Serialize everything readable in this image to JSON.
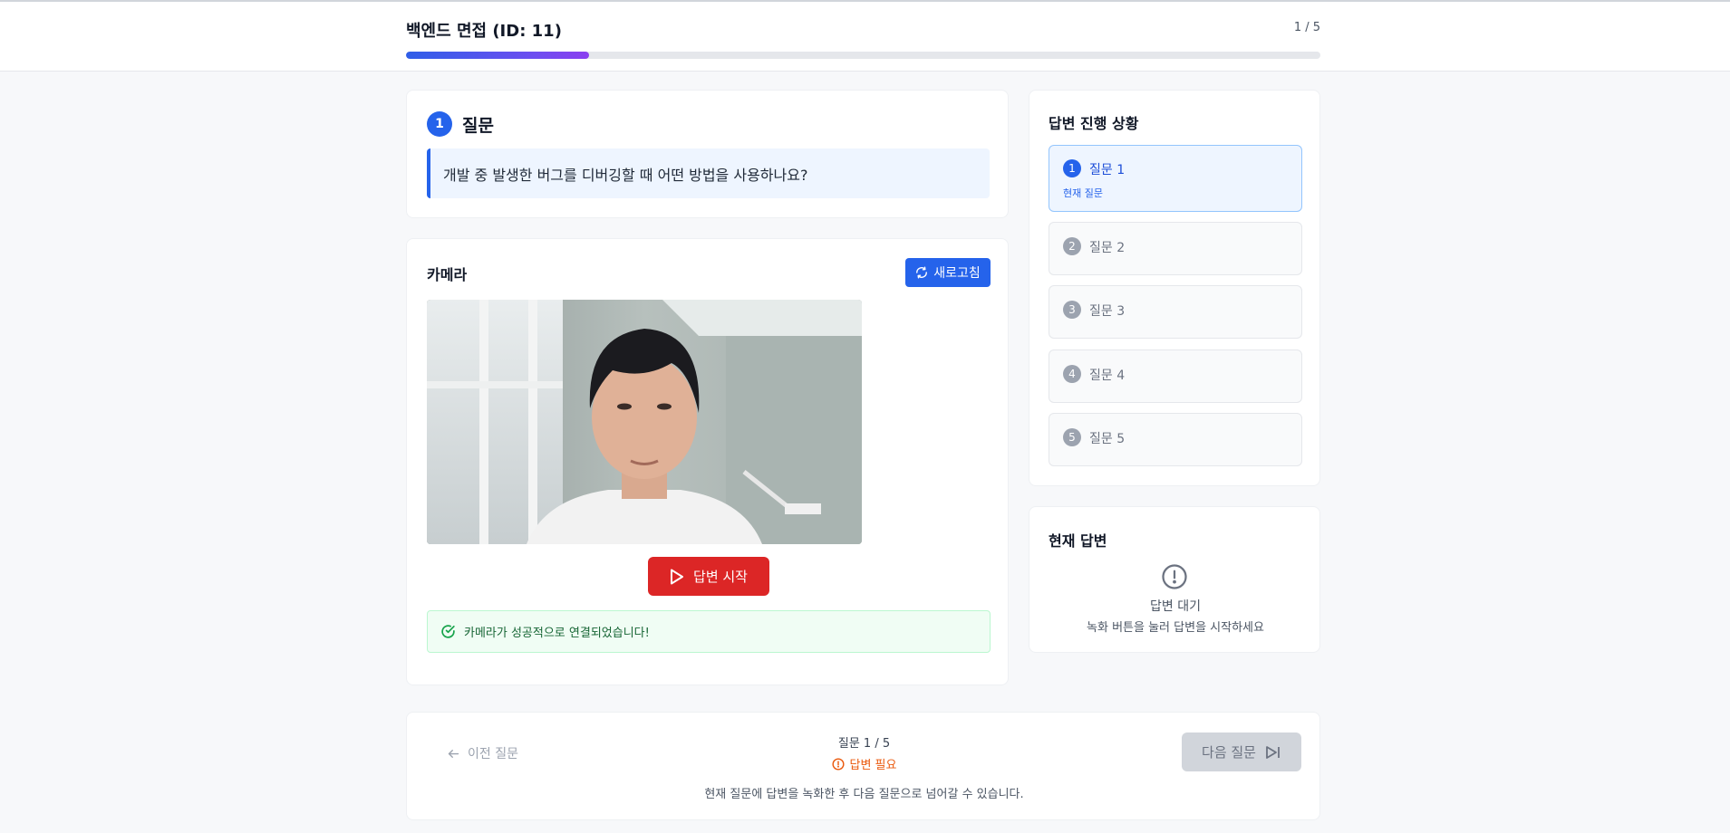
{
  "header": {
    "title": "백엔드 면접 (ID: 11)",
    "counter": "1 / 5",
    "progress": 0.2
  },
  "question": {
    "number": "1",
    "heading": "질문",
    "text": "개발 중 발생한 버그를 디버깅할 때 어떤 방법을 사용하나요?"
  },
  "camera": {
    "title": "카메라",
    "refresh_label": "새로고침",
    "start_label": "답변 시작",
    "success_message": "카메라가 성공적으로 연결되었습니다!"
  },
  "status": {
    "title": "답변 진행 상황",
    "steps": [
      {
        "number": "1",
        "label": "질문 1",
        "sub": "현재 질문"
      },
      {
        "number": "2",
        "label": "질문 2"
      },
      {
        "number": "3",
        "label": "질문 3"
      },
      {
        "number": "4",
        "label": "질문 4"
      },
      {
        "number": "5",
        "label": "질문 5"
      }
    ]
  },
  "answer": {
    "title": "현재 답변",
    "status": "답변 대기",
    "hint": "녹화 버튼을 눌러 답변을 시작하세요"
  },
  "nav": {
    "prev_label": "이전 질문",
    "position": "질문 1 / 5",
    "required": "답변 필요",
    "hint": "현재 질문에 답변을 녹화한 후 다음 질문으로 넘어갈 수 있습니다.",
    "next_label": "다음 질문"
  },
  "colors": {
    "primary": "#2563eb",
    "danger": "#dc2626",
    "success": "#16a34a",
    "warning": "#ea580c"
  }
}
